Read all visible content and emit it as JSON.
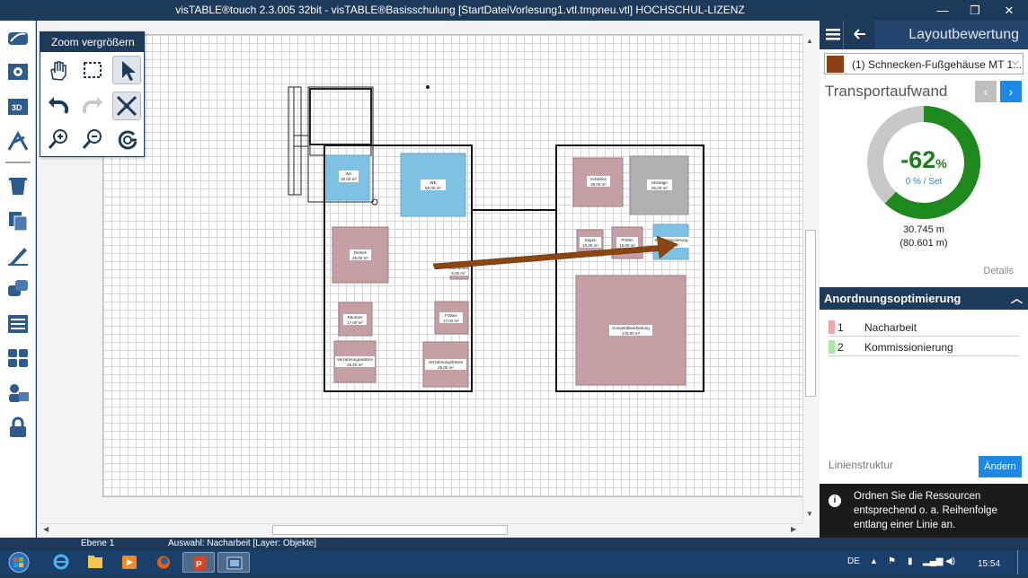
{
  "window": {
    "title": "visTABLE®touch 2.3.005 32bit - visTABLE®Basisschulung [StartDateiVorlesung1.vtl.tmpneu.vtl] HOCHSCHUL-LIZENZ",
    "minimize_glyph": "—",
    "restore_glyph": "❐",
    "close_glyph": "✕"
  },
  "left_toolbar": {
    "icons": [
      "layer-icon",
      "settings-icon",
      "3d-view-icon",
      "edit-tools-icon",
      "delete-icon",
      "copy-icon",
      "draw-icon",
      "group-icon",
      "list-icon",
      "modules-icon",
      "people-icon",
      "lock-icon"
    ]
  },
  "zoom_palette": {
    "title": "Zoom vergrößern",
    "tools": [
      "pan-hand-icon",
      "select-rectangle-icon",
      "pointer-icon",
      "undo-icon",
      "redo-icon",
      "zoom-fit-icon",
      "zoom-in-icon",
      "zoom-out-icon",
      "zoom-reset-icon"
    ]
  },
  "layout": {
    "rooms": [
      {
        "label": "WA",
        "area": "30,00 m²",
        "color": "#7fc1e3"
      },
      {
        "label": "WE",
        "area": "60,00 m²",
        "color": "#7fc1e3"
      },
      {
        "label": "Drehen",
        "area": "48,00 m²",
        "color": "#c4a0a4"
      },
      {
        "label": "Nacharbeit",
        "area": "5,00 m²",
        "color": "#c4a0a4"
      },
      {
        "label": "Räumen",
        "area": "17,00 m²",
        "color": "#c4a0a4"
      },
      {
        "label": "Fräsen",
        "area": "17,00 m²",
        "color": "#c4a0a4"
      },
      {
        "label": "Verzahnungswälzen",
        "area": "25,00 m²",
        "color": "#c4a0a4"
      },
      {
        "label": "Verzahnungsfräsen",
        "area": "25,00 m²",
        "color": "#c4a0a4"
      },
      {
        "label": "Schleifen",
        "area": "35,00 m²",
        "color": "#c4a0a4"
      },
      {
        "label": "Montage",
        "area": "50,00 m²",
        "color": "#b0b0b0"
      },
      {
        "label": "Sägen",
        "area": "10,00 m²",
        "color": "#c4a0a4"
      },
      {
        "label": "Prüfen",
        "area": "15,00 m²",
        "color": "#c4a0a4"
      },
      {
        "label": "Kommissionierung",
        "area": "15,00 m²",
        "color": "#7fc1e3"
      },
      {
        "label": "Komplettbearbeitung",
        "area": "176,00 m²",
        "color": "#c4a0a4"
      }
    ],
    "flow_arrow_color": "#8b4513"
  },
  "right_panel": {
    "header_title": "Layoutbewertung",
    "menu_icon": "hamburger-icon",
    "back_icon": "back-arrow-icon",
    "resource_select": {
      "selected": "(1) Schnecken-Fußgehäuse MT 1...",
      "color": "#8b3f12"
    },
    "transport": {
      "heading": "Transportaufwand",
      "change_value": "-62",
      "change_unit": "%",
      "set_text": "0 % / Set",
      "distance": "30.745 m",
      "distance_ref": "(80.601 m)",
      "details_label": "Details",
      "ring_fraction": 0.62,
      "ring_color": "#1e8a1e",
      "ring_rest_color": "#c8c8c8"
    },
    "optimierung": {
      "title": "Anordnungsoptimierung",
      "items": [
        {
          "num": "1",
          "label": "Nacharbeit",
          "color": "#f2a5a8"
        },
        {
          "num": "2",
          "label": "Kommissionierung",
          "color": "#a9e9a2"
        }
      ]
    },
    "linienstruktur": {
      "label": "Linienstruktur",
      "button": "Ändern"
    },
    "info": {
      "text": "Ordnen Sie die Ressourcen entsprechend o. a. Reihenfolge entlang einer Linie an."
    }
  },
  "status_bar": {
    "ebene": "Ebene 1",
    "auswahl": "Auswahl: Nacharbeit [Layer: Objekte]"
  },
  "taskbar": {
    "lang": "DE",
    "time": "15:54"
  }
}
